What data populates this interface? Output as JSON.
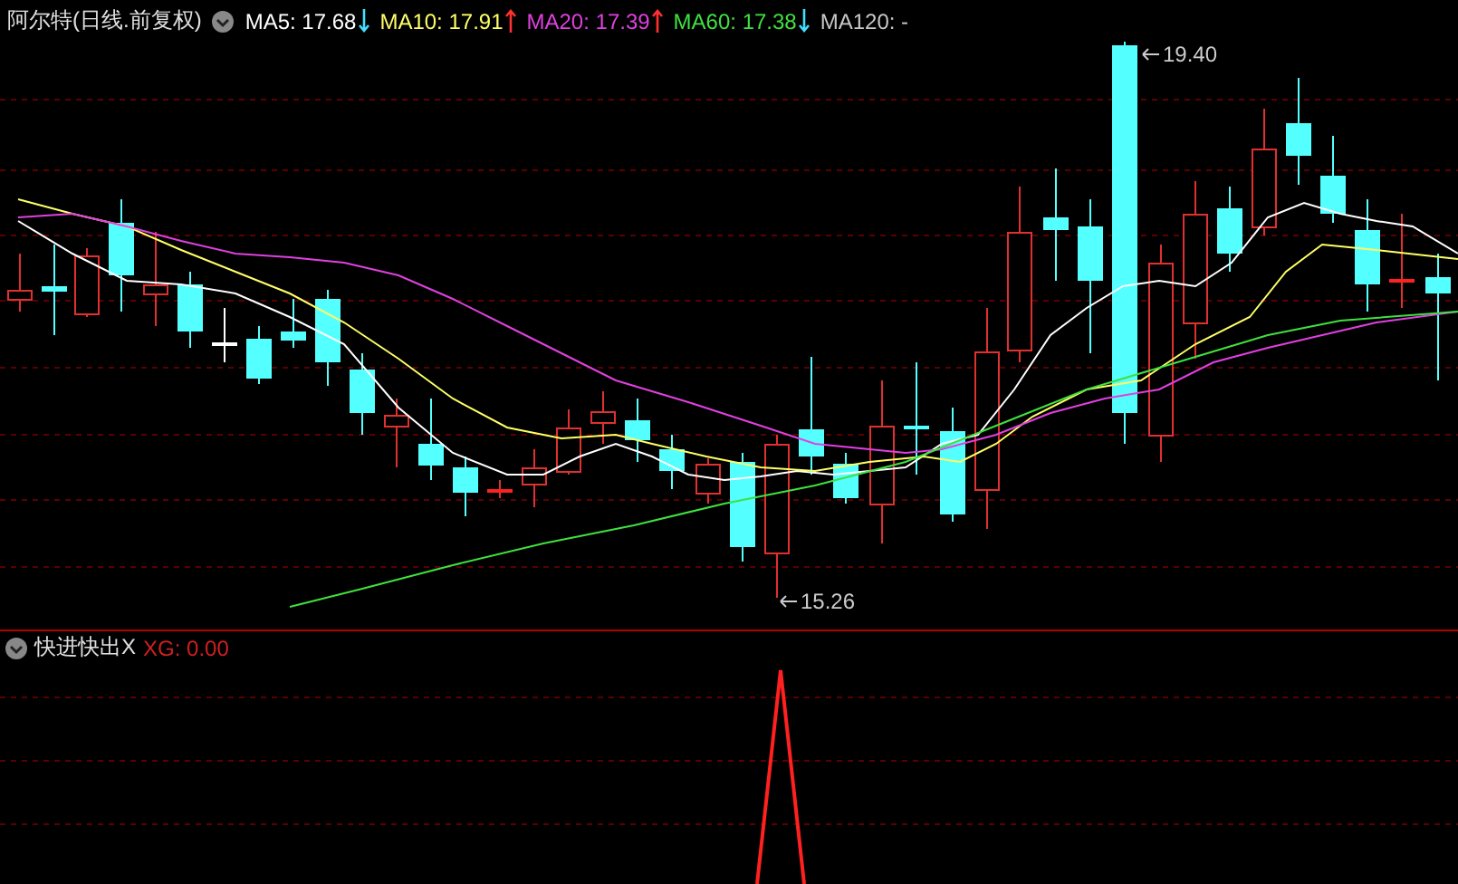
{
  "main_panel": {
    "title": "阿尔特(日线.前复权)",
    "indicators": [
      {
        "label": "MA5: 17.68",
        "color": "#ffffff",
        "kind": "down"
      },
      {
        "label": "MA10: 17.91",
        "color": "#ffff66",
        "kind": "up"
      },
      {
        "label": "MA20: 17.39",
        "color": "#e040e0",
        "kind": "up"
      },
      {
        "label": "MA60: 17.38",
        "color": "#40e040",
        "kind": "down"
      },
      {
        "label": "MA120: -",
        "color": "#c8c8c8",
        "kind": "plain"
      }
    ],
    "price_labels": [
      {
        "text": "19.40"
      },
      {
        "text": "15.26"
      }
    ]
  },
  "sub_panel": {
    "title": "快进快出X",
    "reading": "XG: 0.00"
  }
}
